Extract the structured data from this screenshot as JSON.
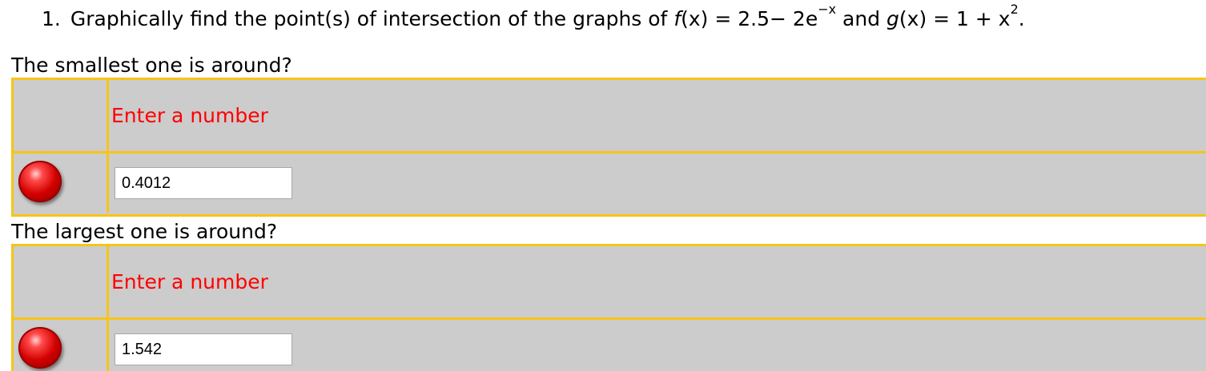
{
  "question": {
    "number": "1.",
    "text_before": "Graphically find the point(s) of intersection of the graphs of ",
    "f_name": "f",
    "f_mid": "(x) = 2.5− 2e",
    "f_exp": "−x",
    "and_text": " and ",
    "g_name": "g",
    "g_mid": "(x) = 1 + x",
    "g_exp": "2",
    "end": "."
  },
  "parts": [
    {
      "prompt": "The smallest one is around?",
      "hint": "Enter a number",
      "value": "0.4012",
      "status_color": "#d40000"
    },
    {
      "prompt": "The largest one is around?",
      "hint": "Enter a number",
      "value": "1.542",
      "status_color": "#d40000"
    }
  ],
  "colors": {
    "border": "#f5c518",
    "panel": "#cccccc",
    "hint": "#ff0000"
  }
}
